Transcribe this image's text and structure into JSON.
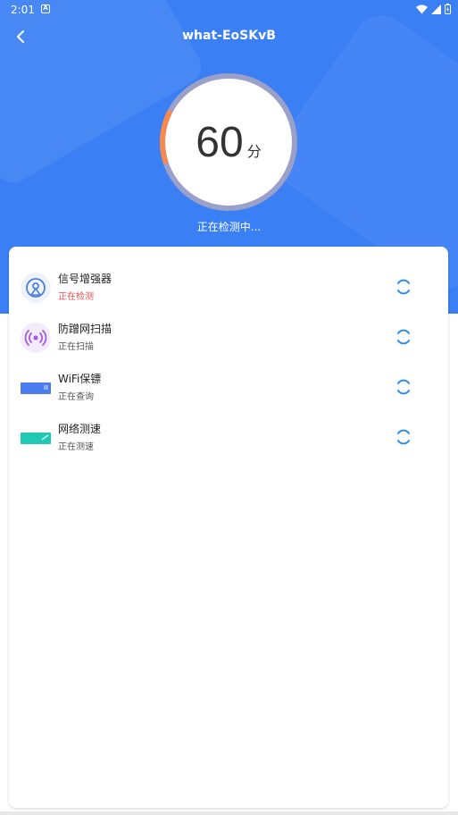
{
  "statusbar": {
    "time": "2:01",
    "notification_letter": "A"
  },
  "header": {
    "title": "what-EoSKvB"
  },
  "gauge": {
    "score": "60",
    "unit": "分",
    "progress_fraction": 0.12,
    "status_text": "正在检测中..."
  },
  "items": [
    {
      "name": "信号增强器",
      "status": "正在检测",
      "status_color": "#e8524f",
      "icon": "signal-tower-icon"
    },
    {
      "name": "防蹭网扫描",
      "status": "正在扫描",
      "icon": "broadcast-scan-icon"
    },
    {
      "name": "WiFi保镖",
      "status": "正在查询",
      "icon": "wifi-guard-icon"
    },
    {
      "name": "网络测速",
      "status": "正在测速",
      "icon": "speed-test-icon"
    }
  ],
  "colors": {
    "primary": "#3b7ff5",
    "accent_orange": "#f5894e",
    "loading_blue": "#2d8cf0"
  }
}
